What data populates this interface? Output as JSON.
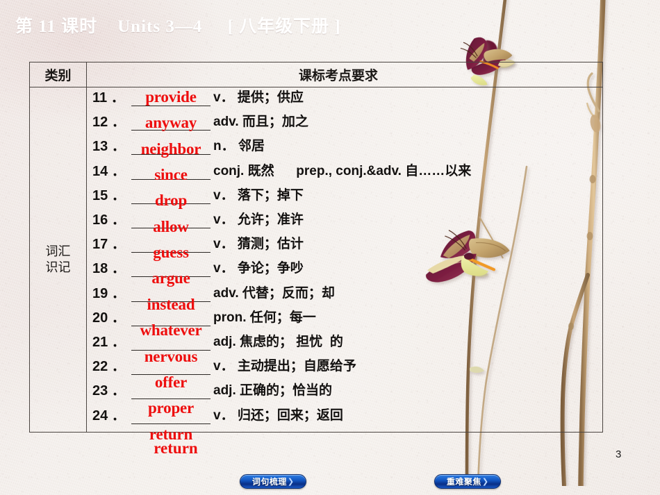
{
  "slide": {
    "title": "第 11 课时    Units 3—4     [ 八年级下册 ]",
    "page_number": "3",
    "background_color": "#f2ece8",
    "answer_color": "#ee0e0e",
    "text_color": "#131110"
  },
  "table": {
    "headers": [
      "类别",
      "课标考点要求"
    ],
    "category_label": "词汇\n识记",
    "rows": [
      {
        "num": "11 ．",
        "answer": "provide",
        "pos": "v．",
        "meaning": "提供；供应"
      },
      {
        "num": "12 ．",
        "answer": "anyway",
        "pos": "adv.",
        "meaning": "而且；加之"
      },
      {
        "num": "13 ．",
        "answer": "neighbor",
        "pos": "n．",
        "meaning": "邻居"
      },
      {
        "num": "14 ．",
        "answer": "since",
        "pos": "conj.",
        "meaning": "既然      prep., conj.&adv. 自……以来"
      },
      {
        "num": "15 ．",
        "answer": "drop",
        "pos": "v．",
        "meaning": "落下；掉下"
      },
      {
        "num": "16 ．",
        "answer": "allow",
        "pos": "v．",
        "meaning": "允许；准许"
      },
      {
        "num": "17 ．",
        "answer": "guess",
        "pos": "v．",
        "meaning": "猜测；估计"
      },
      {
        "num": "18 ．",
        "answer": "argue",
        "pos": "v．",
        "meaning": "争论；争吵"
      },
      {
        "num": "19 ．",
        "answer": "instead",
        "pos": "adv.",
        "meaning": "代替；反而；却"
      },
      {
        "num": "20 ．",
        "answer": "whatever",
        "pos": "pron.",
        "meaning": "任何；每一"
      },
      {
        "num": "21 ．",
        "answer": "nervous",
        "pos": "adj.",
        "meaning": "焦虑的； 担忧  的"
      },
      {
        "num": "22 ．",
        "answer": "offer",
        "pos": "v．",
        "meaning": "主动提出；自愿给予"
      },
      {
        "num": "23 ．",
        "answer": "proper",
        "pos": "adj.",
        "meaning": "正确的；恰当的"
      },
      {
        "num": "24 ．",
        "answer": "return",
        "pos": "v．",
        "meaning": "归还；回来；返回"
      }
    ]
  },
  "nav_buttons": [
    {
      "label": "词句梳理",
      "arrow": "❯"
    },
    {
      "label": "重难聚焦",
      "arrow": "❯"
    }
  ]
}
